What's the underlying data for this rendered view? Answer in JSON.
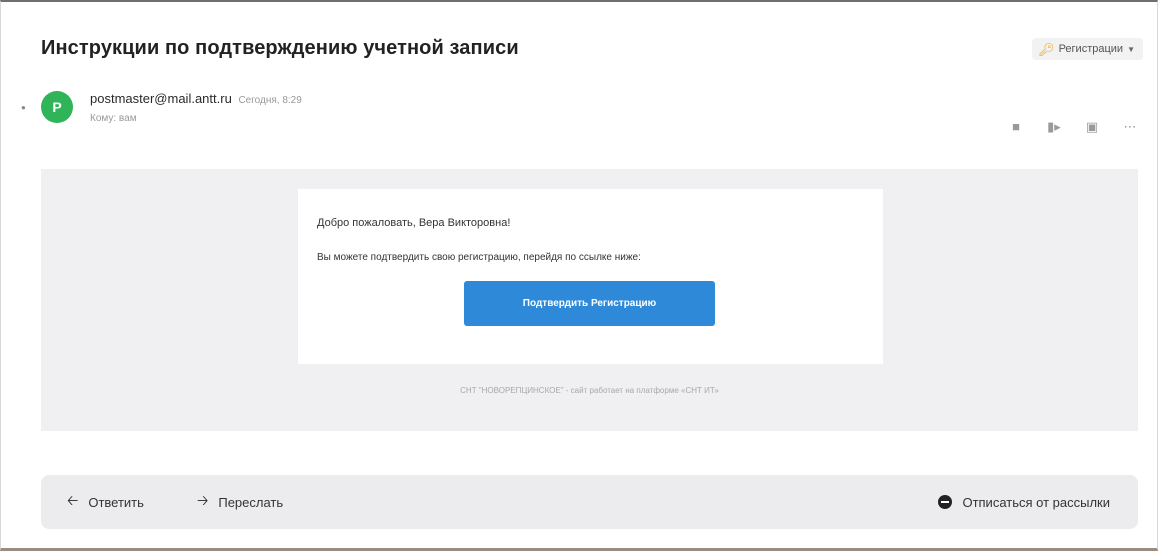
{
  "email": {
    "subject": "Инструкции по подтверждению учетной записи",
    "folder": {
      "label": "Регистрации",
      "icon": "key-icon"
    },
    "sender": {
      "avatar_letter": "P",
      "avatar_color": "#2fb45a",
      "address": "postmaster@mail.antt.ru",
      "time": "Сегодня, 8:29",
      "recipient_line": "Кому: вам"
    },
    "header_actions": [
      "bookmark-icon",
      "move-icon",
      "archive-icon",
      "more-icon"
    ]
  },
  "content": {
    "greeting": "Добро пожаловать, Вера Викторовна!",
    "instruction": "Вы можете подтвердить свою регистрацию, перейдя по ссылке ниже:",
    "confirm_button": "Подтвердить Регистрацию",
    "footnote": "СНТ \"НОВОРЕПЦИНСКОЕ\" - сайт работает на платформе «СНТ ИТ»"
  },
  "toolbar": {
    "reply_label": "Ответить",
    "forward_label": "Переслать",
    "unsubscribe_label": "Отписаться от рассылки"
  },
  "colors": {
    "accent": "#2e8ad9",
    "avatar": "#2fb45a",
    "folder_icon": "#f0a30a"
  }
}
